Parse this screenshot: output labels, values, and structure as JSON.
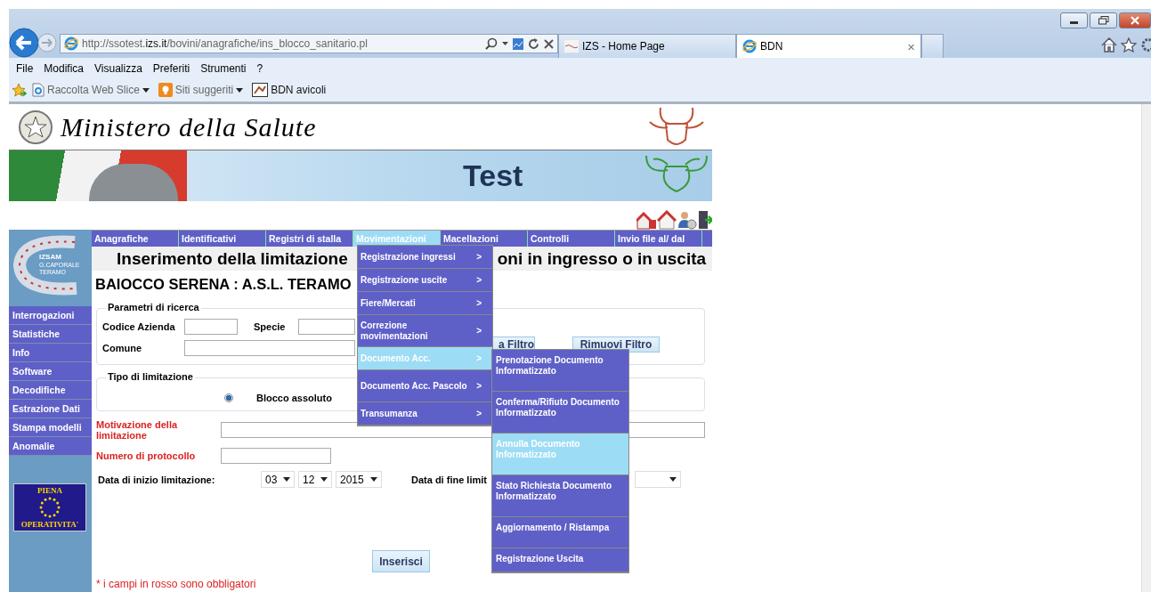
{
  "browser": {
    "url": "http://ssotest.**izs.it**/bovini/anagrafiche/ins_blocco_sanitario.pl",
    "tabs": [
      {
        "label": "IZS - Home Page",
        "selected": false
      },
      {
        "label": "BDN",
        "selected": true,
        "close": "×"
      }
    ],
    "menu": [
      "File",
      "Modifica",
      "Visualizza",
      "Preferiti",
      "Strumenti",
      "?"
    ],
    "favorites": [
      {
        "label": "Raccolta Web Slice",
        "kind": "webslice",
        "dropdown": true
      },
      {
        "label": "Siti suggeriti",
        "kind": "suggested",
        "dropdown": true
      },
      {
        "label": "BDN avicoli",
        "kind": "page",
        "dropdown": false
      }
    ]
  },
  "header": {
    "ministry": "Ministero della Salute",
    "banner": "Test"
  },
  "logo": {
    "name": "IZSAM",
    "lines": [
      "G.CAPORALE",
      "TERAMO"
    ]
  },
  "nav": [
    {
      "label": "Anagrafiche",
      "selected": false
    },
    {
      "label": "Identificativi",
      "selected": false
    },
    {
      "label": "Registri di stalla",
      "selected": false
    },
    {
      "label": "Movimentazioni",
      "selected": true
    },
    {
      "label": "Macellazioni",
      "selected": false
    },
    {
      "label": "Controlli",
      "selected": false
    },
    {
      "label": "Invio file al/ dal",
      "selected": false
    }
  ],
  "sidebar": [
    "Interrogazioni",
    "Statistiche",
    "Info",
    "Software",
    "Decodifiche",
    "Estrazione Dati",
    "Stampa modelli",
    "Anomalie"
  ],
  "badge": {
    "top": "PIENA",
    "bottom": "OPERATIVITA'"
  },
  "title": {
    "before": "Inserimento della limitazione",
    "after": "oni in ingresso o in uscita"
  },
  "user": "BAIOCCO SERENA : A.S.L. TERAMO",
  "search": {
    "legend": "Parametri di ricerca",
    "codice_label": "Codice Azienda",
    "specie_label": "Specie",
    "comune_label": "Comune",
    "buttons": [
      "a Filtro",
      "Rimuovi Filtro"
    ]
  },
  "limit_type": {
    "legend": "Tipo di limitazione",
    "option": "Blocco assoluto",
    "checked": true
  },
  "reason": {
    "label": "Motivazione della limitazione",
    "required": true
  },
  "protocol": {
    "label": "Numero di protocollo",
    "required": true
  },
  "start": {
    "label": "Data di inizio limitazione:",
    "required": false,
    "day": "03",
    "month": "12",
    "year": "2015"
  },
  "end": {
    "label": "Data di fine limit",
    "required": false
  },
  "submit": "Inserisci",
  "footnote": "* i campi in rosso sono obbligatori",
  "dropdown": [
    {
      "label": "Registrazione ingressi",
      "arrow": ">",
      "selected": false
    },
    {
      "label": "Registrazione uscite",
      "arrow": ">",
      "selected": false
    },
    {
      "label": "Fiere/Mercati",
      "arrow": ">",
      "selected": false
    },
    {
      "label": "Correzione movimentazioni",
      "arrow": ">",
      "selected": false
    },
    {
      "label": "Documento Acc.",
      "arrow": ">",
      "selected": true
    },
    {
      "label": "Documento Acc. Pascolo",
      "arrow": ">",
      "selected": false
    },
    {
      "label": "Transumanza",
      "arrow": ">",
      "selected": false
    }
  ],
  "submenu": [
    {
      "label": "Prenotazione Documento Informatizzato",
      "selected": false
    },
    {
      "label": "Conferma/Rifiuto Documento Informatizzato",
      "selected": false
    },
    {
      "label": "Annulla Documento Informatizzato",
      "selected": true
    },
    {
      "label": "Stato Richiesta Documento Informatizzato",
      "selected": false
    },
    {
      "label": "Aggiornamento / Ristampa",
      "selected": false
    },
    {
      "label": "Registrazione Uscita",
      "selected": false
    }
  ]
}
